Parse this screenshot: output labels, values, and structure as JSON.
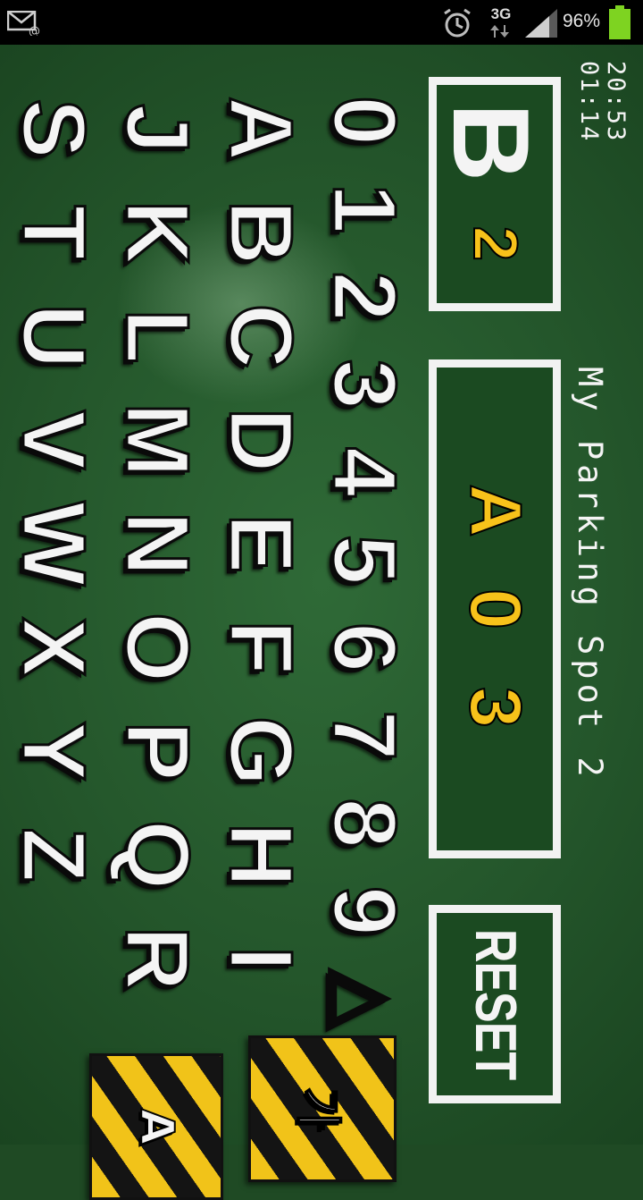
{
  "status_bar": {
    "network": "3G",
    "battery": "96%",
    "icons": [
      "email-notification-icon",
      "alarm-icon",
      "data-arrows-icon",
      "signal-icon",
      "battery-icon"
    ]
  },
  "app": {
    "clock_time": "20:53",
    "clock_elapsed": "01:14",
    "title": "My Parking Spot 2",
    "floor": {
      "letter": "B",
      "number": "2"
    },
    "spot": [
      "A",
      "0",
      "3"
    ],
    "reset_label": "RESET",
    "keyboard": {
      "digits": [
        "0",
        "1",
        "2",
        "3",
        "4",
        "5",
        "6",
        "7",
        "8",
        "9",
        "△"
      ],
      "row_a_i": [
        "A",
        "B",
        "C",
        "D",
        "E",
        "F",
        "G",
        "H",
        "I"
      ],
      "row_j_r": [
        "J",
        "K",
        "L",
        "M",
        "N",
        "O",
        "P",
        "Q",
        "R"
      ],
      "row_s_z": [
        "S",
        "T",
        "U",
        "V",
        "W",
        "X",
        "Y",
        "Z"
      ]
    },
    "mode_buttons": {
      "korean": "가",
      "english": "A"
    },
    "colors": {
      "background": "#24562b",
      "accent": "#f7c21a",
      "frame": "#f2f2f2"
    }
  }
}
